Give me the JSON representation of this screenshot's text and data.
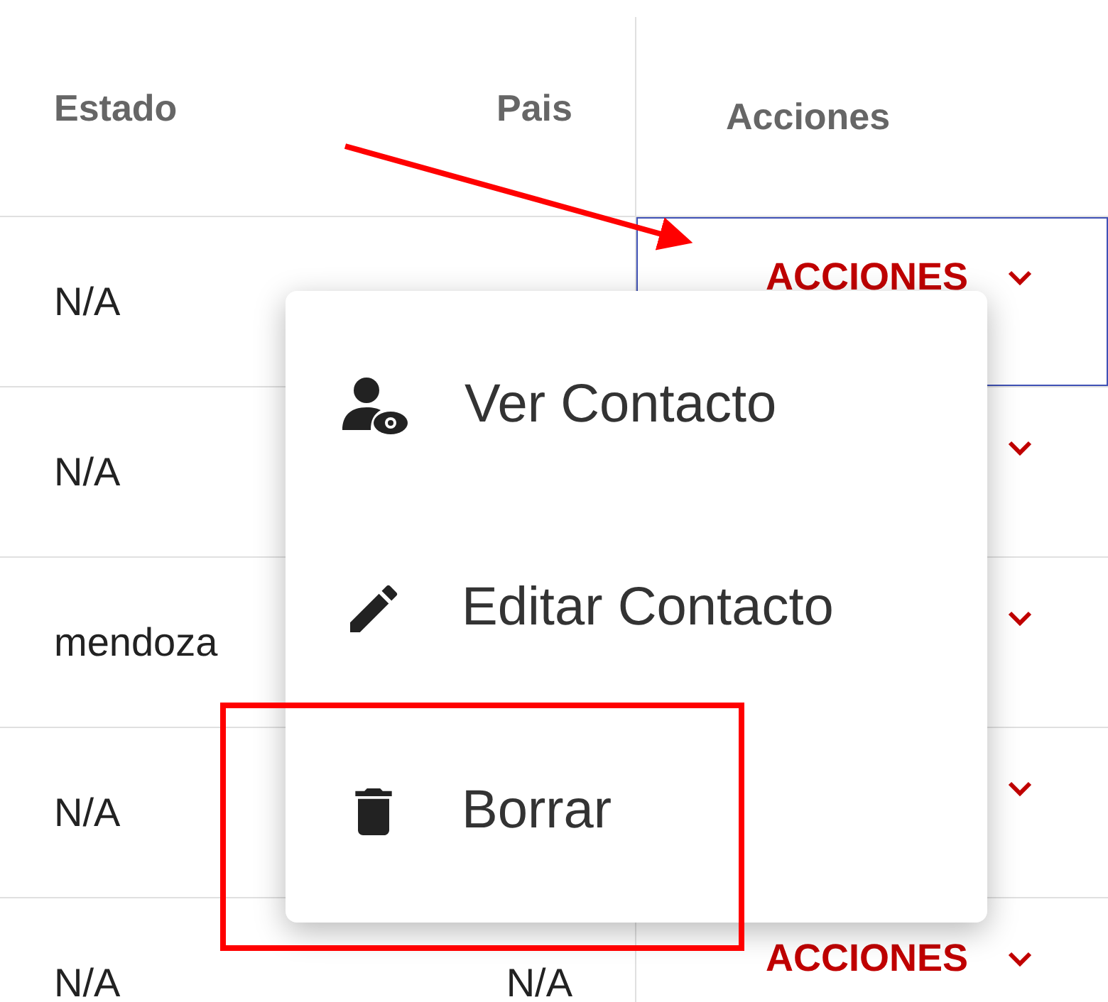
{
  "table": {
    "columns": [
      "Estado",
      "Pais",
      "Acciones"
    ],
    "rows": [
      {
        "estado": "N/A",
        "action_label": "ACCIONES",
        "focused": true
      },
      {
        "estado": "N/A",
        "focused": false
      },
      {
        "estado": "mendoza",
        "focused": false
      },
      {
        "estado": "N/A",
        "focused": false
      },
      {
        "estado": "N/A",
        "pais": "N/A",
        "action_label": "ACCIONES",
        "focused": false
      }
    ]
  },
  "menu": {
    "items": [
      {
        "kind": "view",
        "label": "Ver Contacto"
      },
      {
        "kind": "edit",
        "label": "Editar Contacto"
      },
      {
        "kind": "delete",
        "label": "Borrar"
      }
    ]
  }
}
